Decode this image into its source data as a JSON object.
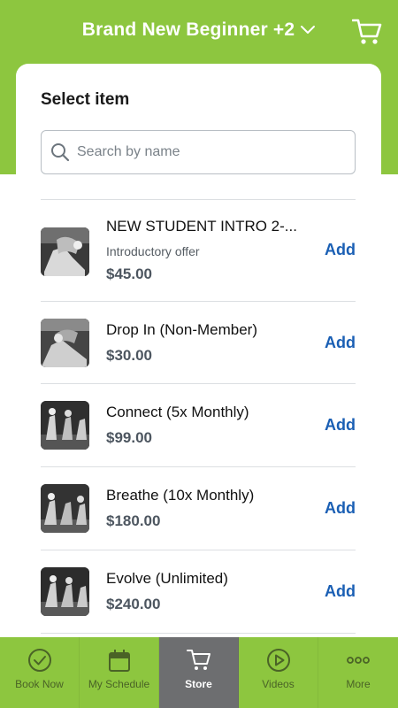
{
  "header": {
    "title": "Brand New Beginner +2",
    "dropdown_icon": "chevron-down-icon",
    "cart_icon": "cart-icon"
  },
  "colors": {
    "brand_green": "#8dc63f",
    "active_tab": "#6d6e70",
    "add_link": "#1a5fb4"
  },
  "store": {
    "title": "Select item",
    "search": {
      "placeholder": "Search by name",
      "value": ""
    }
  },
  "items": [
    {
      "name": "NEW STUDENT INTRO 2-...",
      "subtitle": "Introductory offer",
      "price": "$45.00",
      "action": "Add"
    },
    {
      "name": "Drop In (Non-Member)",
      "subtitle": "",
      "price": "$30.00",
      "action": "Add"
    },
    {
      "name": "Connect (5x Monthly)",
      "subtitle": "",
      "price": "$99.00",
      "action": "Add"
    },
    {
      "name": "Breathe (10x Monthly)",
      "subtitle": "",
      "price": "$180.00",
      "action": "Add"
    },
    {
      "name": "Evolve (Unlimited)",
      "subtitle": "",
      "price": "$240.00",
      "action": "Add"
    }
  ],
  "tabs": [
    {
      "label": "Book Now",
      "icon": "check-circle-icon",
      "active": false
    },
    {
      "label": "My Schedule",
      "icon": "calendar-icon",
      "active": false
    },
    {
      "label": "Store",
      "icon": "cart-icon",
      "active": true
    },
    {
      "label": "Videos",
      "icon": "play-circle-icon",
      "active": false
    },
    {
      "label": "More",
      "icon": "more-dots-icon",
      "active": false
    }
  ]
}
